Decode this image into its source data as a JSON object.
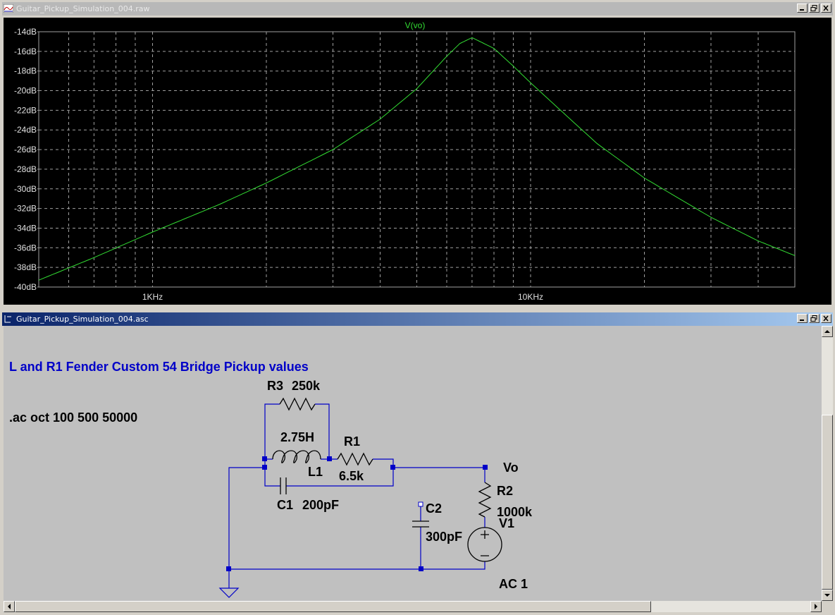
{
  "plot_window": {
    "title": "Guitar_Pickup_Simulation_004.raw",
    "trace_label": "V(vo)",
    "y_ticks": [
      "-14dB",
      "-16dB",
      "-18dB",
      "-20dB",
      "-22dB",
      "-24dB",
      "-26dB",
      "-28dB",
      "-30dB",
      "-32dB",
      "-34dB",
      "-36dB",
      "-38dB",
      "-40dB"
    ],
    "x_ticks": [
      "1KHz",
      "10KHz"
    ],
    "colors": {
      "background": "#000000",
      "grid": "#a0a0a0",
      "trace": "#33dd33",
      "text": "#e0e0e0"
    }
  },
  "chart_data": {
    "type": "line",
    "title": "V(vo)",
    "x_scale": "log",
    "xlim": [
      500,
      50000
    ],
    "ylim": [
      -40,
      -14
    ],
    "y_unit": "dB",
    "series": [
      {
        "name": "V(vo)",
        "x": [
          500,
          700,
          1000,
          1500,
          2000,
          3000,
          4000,
          5000,
          6000,
          6500,
          7000,
          8000,
          9000,
          10000,
          12000,
          15000,
          20000,
          30000,
          40000,
          50000
        ],
        "y": [
          -39.3,
          -37.0,
          -34.4,
          -31.6,
          -29.4,
          -26.0,
          -22.9,
          -19.8,
          -16.5,
          -15.2,
          -14.6,
          -15.7,
          -17.5,
          -19.2,
          -22.0,
          -25.4,
          -28.9,
          -32.9,
          -35.3,
          -36.8
        ]
      }
    ]
  },
  "schematic_window": {
    "title": "Guitar_Pickup_Simulation_004.asc",
    "heading": "L and R1 Fender Custom 54 Bridge Pickup values",
    "directive": ".ac oct 100 500 50000",
    "components": {
      "r3_name": "R3",
      "r3_value": "250k",
      "l1_value": "2.75H",
      "l1_name": "L1",
      "r1_name": "R1",
      "r1_value": "6.5k",
      "c1_name": "C1",
      "c1_value": "200pF",
      "c2_name": "C2",
      "c2_value": "300pF",
      "r2_name": "R2",
      "r2_value": "1000k",
      "v1_name": "V1",
      "v1_value": "AC 1",
      "net_vo": "Vo"
    },
    "colors": {
      "background": "#c0c0c0",
      "wire": "#0000c8",
      "component": "#000000",
      "heading": "#0000c8"
    }
  }
}
